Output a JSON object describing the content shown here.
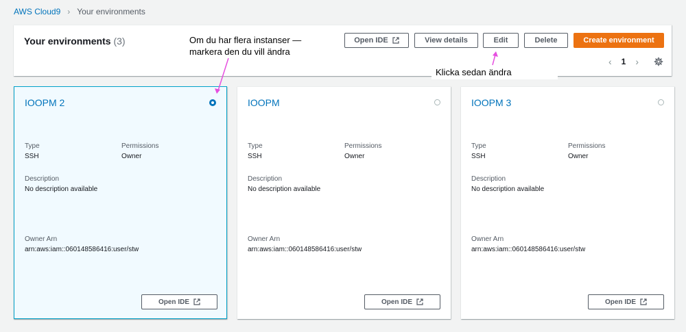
{
  "breadcrumb": {
    "root": "AWS Cloud9",
    "current": "Your environments"
  },
  "header": {
    "title": "Your environments",
    "count": "(3)",
    "buttons": {
      "open_ide": "Open IDE",
      "view_details": "View details",
      "edit": "Edit",
      "delete": "Delete",
      "create": "Create environment"
    },
    "pagination": {
      "page": "1"
    }
  },
  "labels": {
    "type": "Type",
    "permissions": "Permissions",
    "description": "Description",
    "owner_arn": "Owner Arn",
    "open_ide": "Open IDE"
  },
  "cards": [
    {
      "name": "IOOPM 2",
      "selected": true,
      "type": "SSH",
      "permissions": "Owner",
      "description": "No description available",
      "owner_arn": "arn:aws:iam::060148586416:user/stw"
    },
    {
      "name": "IOOPM",
      "selected": false,
      "type": "SSH",
      "permissions": "Owner",
      "description": "No description available",
      "owner_arn": "arn:aws:iam::060148586416:user/stw"
    },
    {
      "name": "IOOPM 3",
      "selected": false,
      "type": "SSH",
      "permissions": "Owner",
      "description": "No description available",
      "owner_arn": "arn:aws:iam::060148586416:user/stw"
    }
  ],
  "annotations": {
    "select_line1": "Om du har flera instanser —",
    "select_line2": "markera den du vill ändra",
    "edit_hint": "Klicka sedan ändra"
  },
  "colors": {
    "accent": "#0073bb",
    "primary_button": "#ec7211",
    "annotation_arrow": "#e64fe0",
    "selected_border": "#00a1c9"
  },
  "icons": [
    "external-link-icon",
    "chevron-left-icon",
    "chevron-right-icon",
    "gear-icon",
    "radio-icon"
  ]
}
